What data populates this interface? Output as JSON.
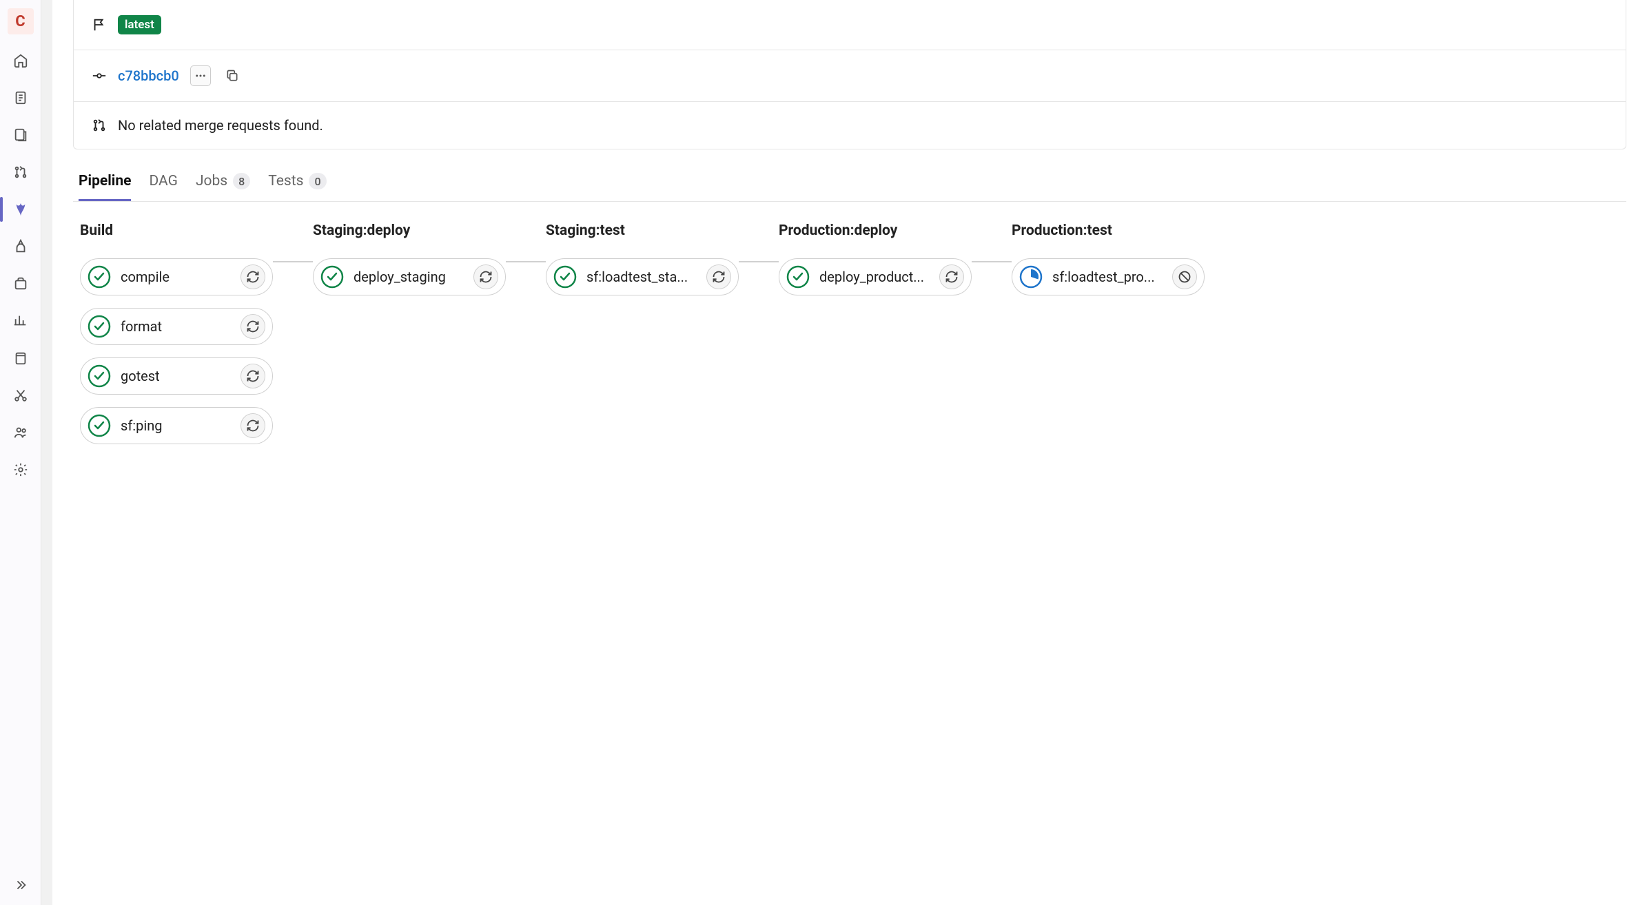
{
  "sidebar": {
    "avatar_letter": "C",
    "icons": [
      "home-icon",
      "plan-icon",
      "code-icon",
      "merge-request-icon",
      "cicd-icon",
      "deploy-icon",
      "packages-icon",
      "monitor-icon",
      "wiki-icon",
      "snippets-icon",
      "members-icon",
      "settings-icon"
    ],
    "expand_icon": "chevrons-right-icon"
  },
  "commit": {
    "latest_label": "latest",
    "sha": "c78bbcb0",
    "mr_empty": "No related merge requests found."
  },
  "tabs": {
    "pipeline": "Pipeline",
    "dag": "DAG",
    "jobs_label": "Jobs",
    "jobs_count": "8",
    "tests_label": "Tests",
    "tests_count": "0"
  },
  "stages": [
    {
      "title": "Build",
      "jobs": [
        {
          "name": "compile",
          "status": "passed",
          "action": "retry"
        },
        {
          "name": "format",
          "status": "passed",
          "action": "retry"
        },
        {
          "name": "gotest",
          "status": "passed",
          "action": "retry"
        },
        {
          "name": "sf:ping",
          "status": "passed",
          "action": "retry"
        }
      ]
    },
    {
      "title": "Staging:deploy",
      "jobs": [
        {
          "name": "deploy_staging",
          "status": "passed",
          "action": "retry"
        }
      ]
    },
    {
      "title": "Staging:test",
      "jobs": [
        {
          "name": "sf:loadtest_sta...",
          "status": "passed",
          "action": "retry"
        }
      ]
    },
    {
      "title": "Production:deploy",
      "jobs": [
        {
          "name": "deploy_product...",
          "status": "passed",
          "action": "retry"
        }
      ]
    },
    {
      "title": "Production:test",
      "jobs": [
        {
          "name": "sf:loadtest_pro...",
          "status": "running",
          "action": "cancel"
        }
      ]
    }
  ]
}
